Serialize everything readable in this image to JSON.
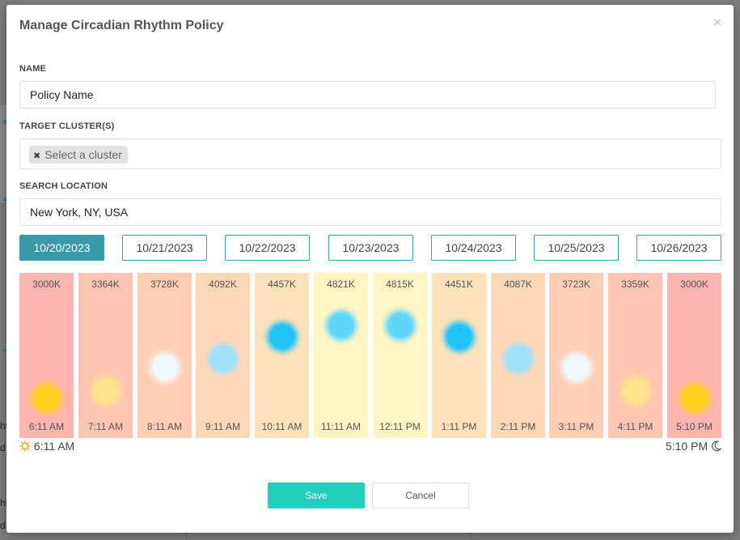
{
  "background": {
    "fragments": [
      "ht",
      "d",
      "ht",
      "d"
    ]
  },
  "dialog": {
    "title": "Manage Circadian Rhythm Policy",
    "close_symbol": "×"
  },
  "form": {
    "name_label": "NAME",
    "name_value": "Policy Name",
    "cluster_label": "TARGET CLUSTER(S)",
    "cluster_tag": "Select a cluster",
    "cluster_tag_remove": "✖",
    "location_label": "SEARCH LOCATION",
    "location_value": "New York, NY, USA"
  },
  "dates": [
    "10/20/2023",
    "10/21/2023",
    "10/22/2023",
    "10/23/2023",
    "10/24/2023",
    "10/25/2023",
    "10/26/2023"
  ],
  "selected_date": "10/20/2023",
  "schedule": [
    {
      "kelvin": "3000K",
      "time": "6:11 AM",
      "bg": "#ffb5b0",
      "orb": "#ffd21f",
      "level": 0.0
    },
    {
      "kelvin": "3364K",
      "time": "7:11 AM",
      "bg": "#ffc4b2",
      "orb": "#fde38c",
      "level": 0.1
    },
    {
      "kelvin": "3728K",
      "time": "8:11 AM",
      "bg": "#ffceb5",
      "orb": "#eef8fe",
      "level": 0.42
    },
    {
      "kelvin": "4092K",
      "time": "9:11 AM",
      "bg": "#ffd8b8",
      "orb": "#9ee1f8",
      "level": 0.55
    },
    {
      "kelvin": "4457K",
      "time": "10:11 AM",
      "bg": "#ffe2ba",
      "orb": "#1ec4f6",
      "level": 0.85
    },
    {
      "kelvin": "4821K",
      "time": "11:11 AM",
      "bg": "#fff6c4",
      "orb": "#5fd6fb",
      "level": 1.0
    },
    {
      "kelvin": "4815K",
      "time": "12:11 PM",
      "bg": "#fff6c4",
      "orb": "#5fd6fb",
      "level": 1.0
    },
    {
      "kelvin": "4451K",
      "time": "1:11 PM",
      "bg": "#ffe2ba",
      "orb": "#1ec4f6",
      "level": 0.85
    },
    {
      "kelvin": "4087K",
      "time": "2:11 PM",
      "bg": "#ffd8b8",
      "orb": "#9ee1f8",
      "level": 0.55
    },
    {
      "kelvin": "3723K",
      "time": "3:11 PM",
      "bg": "#ffceb5",
      "orb": "#eef8fe",
      "level": 0.42
    },
    {
      "kelvin": "3359K",
      "time": "4:11 PM",
      "bg": "#ffc4b2",
      "orb": "#fde38c",
      "level": 0.1
    },
    {
      "kelvin": "3000K",
      "time": "5:10 PM",
      "bg": "#ffb5b0",
      "orb": "#ffd21f",
      "level": 0.0
    }
  ],
  "sunrise": {
    "time": "6:11 AM",
    "icon": "sun-icon"
  },
  "sunset": {
    "time": "5:10 PM",
    "icon": "moon-icon"
  },
  "buttons": {
    "save": "Save",
    "cancel": "Cancel"
  },
  "colors": {
    "accent": "#1fd1bd",
    "active_tab": "#3a9aaa",
    "tab_border": "#2aa9b2"
  }
}
